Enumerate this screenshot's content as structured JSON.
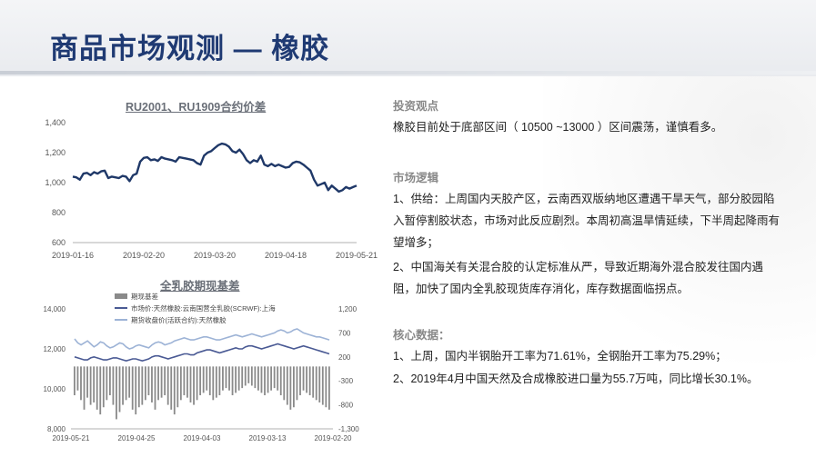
{
  "slide": {
    "title": "商品市场观测 — 橡胶"
  },
  "chart1": {
    "title": "RU2001、RU1909合约价差"
  },
  "chart2": {
    "title": "全乳胶期现基差",
    "legend": [
      "期现基差",
      "市场价:天然橡胶:云南国营全乳胶(SCRWF):上海",
      "期货收盘价(活跃合约):天然橡胶"
    ]
  },
  "chart_data": [
    {
      "type": "line",
      "title": "RU2001、RU1909合约价差",
      "x": [
        "2019-01-16",
        "2019-01-17",
        "2019-01-18",
        "2019-01-21",
        "2019-01-22",
        "2019-01-23",
        "2019-01-24",
        "2019-01-25",
        "2019-01-28",
        "2019-01-29",
        "2019-01-30",
        "2019-01-31",
        "2019-02-01",
        "2019-02-11",
        "2019-02-12",
        "2019-02-13",
        "2019-02-14",
        "2019-02-15",
        "2019-02-18",
        "2019-02-19",
        "2019-02-20",
        "2019-02-21",
        "2019-02-22",
        "2019-02-25",
        "2019-02-26",
        "2019-02-27",
        "2019-02-28",
        "2019-03-01",
        "2019-03-04",
        "2019-03-05",
        "2019-03-06",
        "2019-03-07",
        "2019-03-08",
        "2019-03-11",
        "2019-03-12",
        "2019-03-13",
        "2019-03-14",
        "2019-03-15",
        "2019-03-18",
        "2019-03-19",
        "2019-03-20",
        "2019-03-21",
        "2019-03-22",
        "2019-03-25",
        "2019-03-26",
        "2019-03-27",
        "2019-03-28",
        "2019-03-29",
        "2019-04-01",
        "2019-04-02",
        "2019-04-03",
        "2019-04-04",
        "2019-04-08",
        "2019-04-09",
        "2019-04-10",
        "2019-04-11",
        "2019-04-12",
        "2019-04-15",
        "2019-04-16",
        "2019-04-17",
        "2019-04-18",
        "2019-04-19",
        "2019-04-22",
        "2019-04-23",
        "2019-04-24",
        "2019-04-25",
        "2019-04-26",
        "2019-04-29",
        "2019-04-30",
        "2019-05-06",
        "2019-05-07",
        "2019-05-08",
        "2019-05-09",
        "2019-05-10",
        "2019-05-13",
        "2019-05-14",
        "2019-05-15",
        "2019-05-16",
        "2019-05-17",
        "2019-05-20",
        "2019-05-21"
      ],
      "values": [
        1040,
        1035,
        1020,
        1060,
        1065,
        1050,
        1070,
        1060,
        1075,
        1080,
        1030,
        1040,
        1035,
        1030,
        1045,
        1040,
        1010,
        1050,
        1060,
        1140,
        1165,
        1170,
        1150,
        1155,
        1145,
        1170,
        1160,
        1155,
        1150,
        1140,
        1170,
        1165,
        1160,
        1155,
        1150,
        1130,
        1120,
        1180,
        1200,
        1210,
        1230,
        1250,
        1260,
        1255,
        1240,
        1210,
        1200,
        1220,
        1190,
        1150,
        1130,
        1150,
        1140,
        1180,
        1120,
        1110,
        1125,
        1110,
        1120,
        1110,
        1100,
        1105,
        1130,
        1140,
        1135,
        1120,
        1100,
        1080,
        1020,
        980,
        990,
        1000,
        950,
        980,
        960,
        940,
        950,
        970,
        960,
        970,
        980
      ],
      "xticks": [
        "2019-01-16",
        "2019-02-20",
        "2019-03-20",
        "2019-04-18",
        "2019-05-21"
      ],
      "yticks": [
        "600",
        "800",
        "1,000",
        "1,200",
        "1,400"
      ],
      "ylim": [
        600,
        1400
      ]
    },
    {
      "type": "line+bar",
      "title": "全乳胶期现基差",
      "xticks": [
        "2019-05-21",
        "2019-04-25",
        "2019-04-03",
        "2019-03-13",
        "2019-02-20"
      ],
      "yticks_left": [
        "8,000",
        "10,000",
        "12,000",
        "14,000"
      ],
      "yticks_right": [
        "-1,300",
        "-800",
        "-300",
        "200",
        "700",
        "1,200"
      ],
      "ylim_left": [
        8000,
        14000
      ],
      "ylim_right": [
        -1300,
        1200
      ],
      "series": [
        {
          "name": "期现基差",
          "type": "bar",
          "axis": "right",
          "values": [
            -600,
            -500,
            -700,
            -900,
            -650,
            -800,
            -750,
            -900,
            -1000,
            -850,
            -700,
            -600,
            -800,
            -1100,
            -950,
            -800,
            -700,
            -650,
            -900,
            -1000,
            -850,
            -800,
            -700,
            -600,
            -750,
            -900,
            -700,
            -650,
            -600,
            -800,
            -900,
            -1000,
            -850,
            -700,
            -600,
            -650,
            -750,
            -800,
            -700,
            -600,
            -550,
            -500,
            -600,
            -700,
            -650,
            -600,
            -500,
            -450,
            -500,
            -600,
            -550,
            -500,
            -450,
            -400,
            -350,
            -400,
            -450,
            -500,
            -550,
            -600,
            -550,
            -500,
            -450,
            -500,
            -600,
            -700,
            -800,
            -900,
            -850,
            -700,
            -600,
            -500,
            -550,
            -600,
            -650,
            -700,
            -750,
            -800,
            -850,
            -900
          ]
        },
        {
          "name": "市场价:天然橡胶:云南国营全乳胶(SCRWF):上海",
          "type": "line",
          "axis": "left",
          "values": [
            11600,
            11550,
            11500,
            11450,
            11450,
            11550,
            11600,
            11550,
            11500,
            11450,
            11450,
            11500,
            11550,
            11550,
            11500,
            11450,
            11400,
            11450,
            11500,
            11500,
            11450,
            11400,
            11450,
            11500,
            11600,
            11650,
            11650,
            11600,
            11550,
            11500,
            11550,
            11600,
            11650,
            11700,
            11750,
            11750,
            11700,
            11700,
            11800,
            11850,
            11900,
            11950,
            11950,
            11900,
            11850,
            11800,
            11850,
            11900,
            11950,
            12000,
            12050,
            12000,
            12000,
            12100,
            12150,
            12150,
            12100,
            12050,
            12000,
            12050,
            12100,
            12150,
            12200,
            12250,
            12200,
            12150,
            12100,
            12050,
            12000,
            12050,
            12100,
            12150,
            12100,
            12050,
            12000,
            11950,
            11900,
            11850,
            11800,
            11750
          ]
        },
        {
          "name": "期货收盘价(活跃合约):天然橡胶",
          "type": "line",
          "axis": "left",
          "values": [
            12500,
            12300,
            12200,
            12300,
            12400,
            12250,
            12100,
            12200,
            12350,
            12300,
            12150,
            12050,
            12100,
            12200,
            12300,
            12250,
            12100,
            12000,
            12050,
            12150,
            12200,
            12150,
            12100,
            12050,
            12200,
            12300,
            12350,
            12300,
            12200,
            12250,
            12300,
            12400,
            12450,
            12500,
            12550,
            12500,
            12450,
            12450,
            12500,
            12550,
            12600,
            12600,
            12550,
            12500,
            12450,
            12450,
            12500,
            12550,
            12600,
            12650,
            12700,
            12650,
            12600,
            12650,
            12700,
            12750,
            12700,
            12650,
            12600,
            12650,
            12700,
            12750,
            12800,
            12900,
            12950,
            12900,
            12800,
            12850,
            12950,
            13000,
            12900,
            12800,
            12750,
            12700,
            12650,
            12600,
            12600,
            12550,
            12500,
            12450
          ]
        }
      ]
    }
  ],
  "right": {
    "section1_title": "投资观点",
    "section1_text": "橡胶目前处于底部区间（ 10500 ~13000 ）区间震荡，谨慎看多。",
    "section2_title": "市场逻辑",
    "section2_p1": "1、供给：上周国内天胶产区，云南西双版纳地区遭遇干旱天气，部分胶园陷入暂停割胶状态，市场对此反应剧烈。本周初高温旱情延续，下半周起降雨有望增多；",
    "section2_p2": "2、中国海关有关混合胶的认定标准从严，导致近期海外混合胶发往国内遇阻，加快了国内全乳胶现货库存消化，库存数据面临拐点。",
    "section3_title": "核心数据：",
    "section3_p1": "1、上周，国内半钢胎开工率为71.61%，全钢胎开工率为75.29%；",
    "section3_p2": "2、2019年4月中国天然及合成橡胶进口量为55.7万吨，同比增长30.1%。"
  },
  "colors": {
    "title": "#1f3a73",
    "chart1_line": "#1f3868",
    "spot_line": "#4a5a94",
    "futures_line": "#9db3d6",
    "basis_bar": "#8a8a8a"
  }
}
